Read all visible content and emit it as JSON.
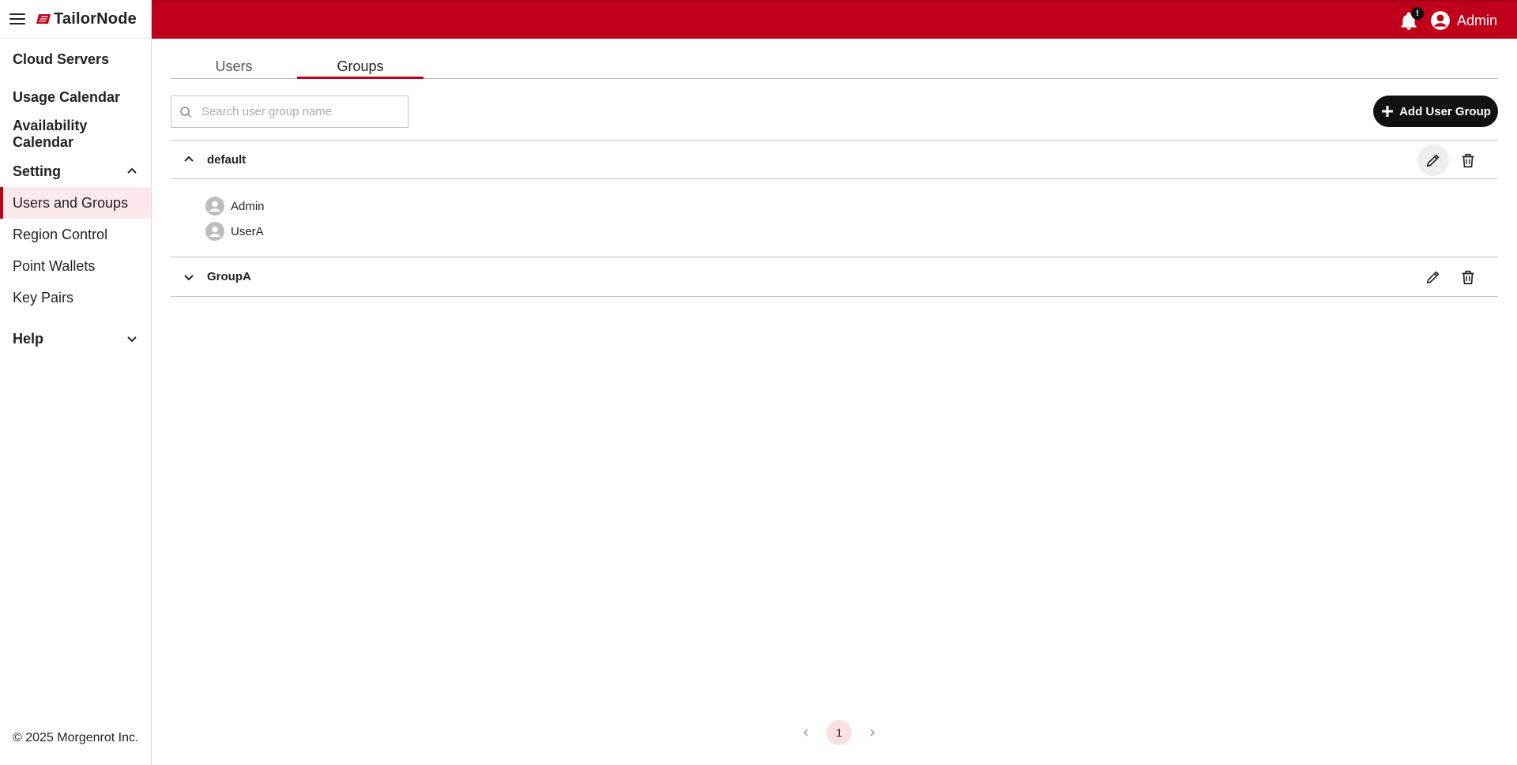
{
  "app": {
    "brand": "TailorNode",
    "accent_color": "#c0001a",
    "copyright": "© 2025 Morgenrot Inc."
  },
  "header": {
    "notification_badge": "!",
    "user_name": "Admin"
  },
  "sidebar": {
    "items": [
      {
        "label": "Cloud Servers"
      },
      {
        "label": "Usage Calendar"
      },
      {
        "label": "Availability Calendar"
      },
      {
        "label": "Setting",
        "expanded": true
      },
      {
        "label": "Users and Groups",
        "active": true
      },
      {
        "label": "Region Control"
      },
      {
        "label": "Point Wallets"
      },
      {
        "label": "Key Pairs"
      },
      {
        "label": "Help",
        "expanded": false
      }
    ]
  },
  "tabs": [
    {
      "label": "Users",
      "active": false
    },
    {
      "label": "Groups",
      "active": true
    }
  ],
  "search": {
    "placeholder": "Search user group name",
    "value": ""
  },
  "add_button": {
    "label": "Add User Group",
    "icon": "plus-icon"
  },
  "groups": [
    {
      "name": "default",
      "expanded": true,
      "members": [
        "Admin",
        "UserA"
      ]
    },
    {
      "name": "GroupA",
      "expanded": false,
      "members": []
    }
  ],
  "pagination": {
    "current_page": "1"
  }
}
